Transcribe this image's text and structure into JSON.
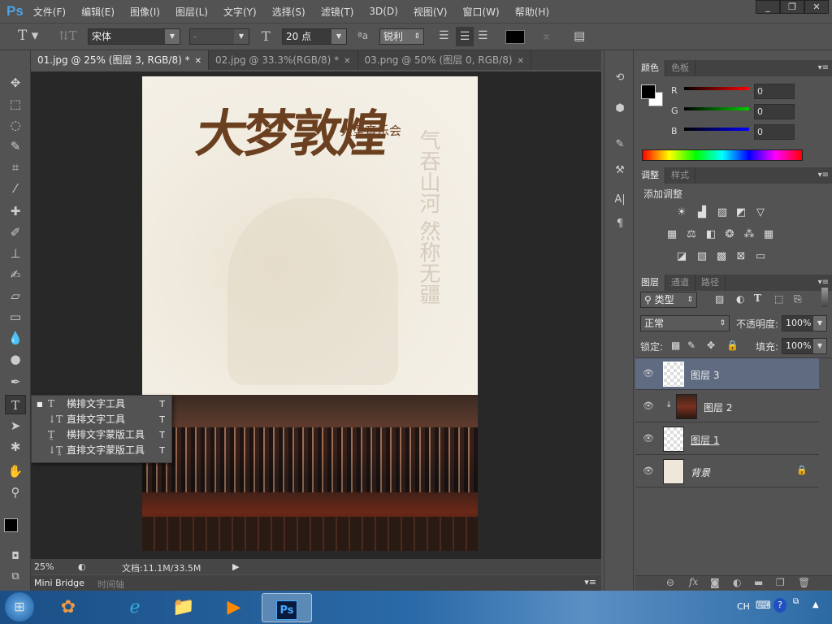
{
  "app": {
    "logo": "Ps"
  },
  "menu": [
    "文件(F)",
    "编辑(E)",
    "图像(I)",
    "图层(L)",
    "文字(Y)",
    "选择(S)",
    "滤镜(T)",
    "3D(D)",
    "视图(V)",
    "窗口(W)",
    "帮助(H)"
  ],
  "options": {
    "font_family": "宋体",
    "font_style": "-",
    "font_size": "20 点",
    "antialias": "锐利",
    "text_color": "#000000"
  },
  "tabs": [
    {
      "label": "01.jpg @ 25% (图层 3, RGB/8) *"
    },
    {
      "label": "02.jpg @ 33.3%(RGB/8) *"
    },
    {
      "label": "03.png @ 50% (图层 0, RGB/8)"
    }
  ],
  "poster": {
    "title": "大梦敦煌",
    "subtitle": "大型音乐会",
    "side_text": "气吞山河 然称无疆"
  },
  "flyout": [
    {
      "label": "横排文字工具",
      "key": "T",
      "active": true
    },
    {
      "label": "直排文字工具",
      "key": "T"
    },
    {
      "label": "横排文字蒙版工具",
      "key": "T"
    },
    {
      "label": "直排文字蒙版工具",
      "key": "T"
    }
  ],
  "status": {
    "zoom": "25%",
    "doc": "文档:11.1M/33.5M"
  },
  "bottom_tabs": [
    "Mini Bridge",
    "时间轴"
  ],
  "color_panel": {
    "tabs": [
      "颜色",
      "色板"
    ],
    "r": "0",
    "g": "0",
    "b": "0",
    "labels": [
      "R",
      "G",
      "B"
    ]
  },
  "adjust_panel": {
    "tabs": [
      "调整",
      "样式"
    ],
    "title": "添加调整"
  },
  "layers_panel": {
    "tabs": [
      "图层",
      "通道",
      "路径"
    ],
    "filter": "类型",
    "blend": "正常",
    "opacity_label": "不透明度:",
    "opacity": "100%",
    "lock_label": "锁定:",
    "fill_label": "填充:",
    "fill": "100%",
    "layers": [
      {
        "name": "图层 3",
        "selected": true
      },
      {
        "name": "图层 2",
        "clipped": true
      },
      {
        "name": "图层 1"
      },
      {
        "name": "背景",
        "locked": true
      }
    ]
  },
  "taskbar": {
    "lang": "CH"
  }
}
